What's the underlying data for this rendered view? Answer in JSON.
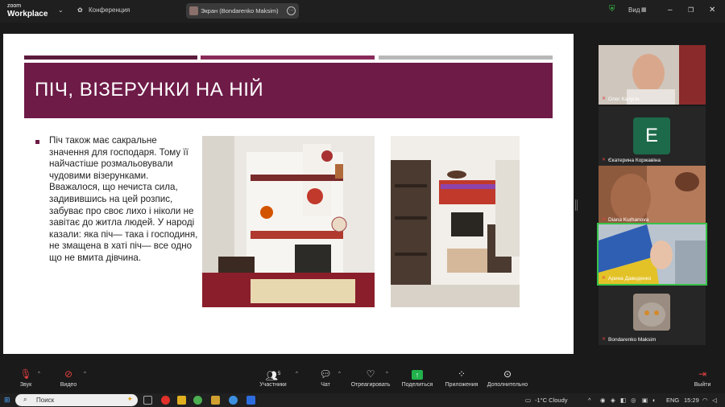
{
  "app": {
    "logo_line1": "zoom",
    "logo_line2": "Workplace",
    "meeting_label": "Конференция",
    "screen_share_label": "Экран (Bondarenko Maksim)",
    "view_label": "Вид",
    "brand_color": "#6e1b48"
  },
  "slide": {
    "title": "ПІЧ, ВІЗЕРУНКИ НА НІЙ",
    "body": "Піч також має сакральне значення для господаря. Тому її найчастіше розмальовували чудовими візерунками. Вважалося, що нечиста сила, задивившись на цей розпис, забуває про своє лихо і ніколи не завітає до житла людей. У народі казали: яка піч— така і господиня, не змащена в хаті піч— все одно що не вмита дівчина."
  },
  "participants": [
    {
      "name": "Олег Калугін"
    },
    {
      "name": "Єкатерина Коржавіна",
      "initial": "E"
    },
    {
      "name": "Diana Kurhanova"
    },
    {
      "name": "Арина Давиденко"
    },
    {
      "name": "Bondarenko Maksim"
    }
  ],
  "controls": {
    "audio": "Звук",
    "video": "Видео",
    "participants": "Участники",
    "participants_count": "5",
    "chat": "Чат",
    "react": "Отреагировать",
    "share": "Поделиться",
    "apps": "Приложения",
    "more": "Дополнительно",
    "leave": "Выйти"
  },
  "taskbar": {
    "search_placeholder": "Поиск",
    "weather": "-1°C  Cloudy",
    "lang": "ENG",
    "time": "15:29"
  }
}
